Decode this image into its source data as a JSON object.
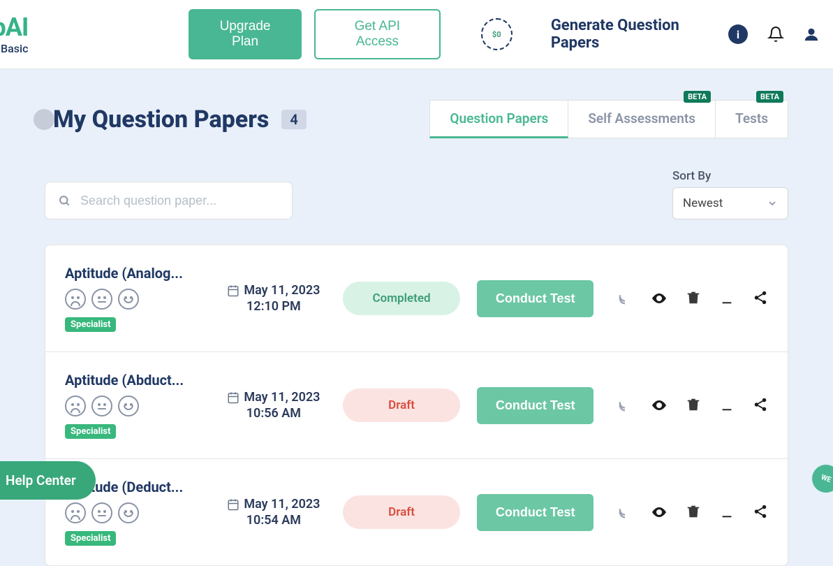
{
  "brand": {
    "main": "epAI",
    "sub": "Basic"
  },
  "header": {
    "upgrade_label": "Upgrade Plan",
    "api_label": "Get API Access",
    "credit": "$0",
    "generate_label": "Generate Question Papers"
  },
  "page": {
    "title": "My Question Papers",
    "count": "4"
  },
  "tabs": [
    {
      "label": "Question Papers",
      "active": true,
      "beta": false
    },
    {
      "label": "Self Assessments",
      "active": false,
      "beta": true
    },
    {
      "label": "Tests",
      "active": false,
      "beta": true
    }
  ],
  "search": {
    "placeholder": "Search question paper..."
  },
  "sort": {
    "label": "Sort By",
    "value": "Newest"
  },
  "status_labels": {
    "completed": "Completed",
    "draft": "Draft"
  },
  "conduct_label": "Conduct Test",
  "tag_label": "Specialist",
  "beta_label": "BETA",
  "papers": [
    {
      "title": "Aptitude (Analog...",
      "date": "May 11, 2023",
      "time": "12:10 PM",
      "status": "completed"
    },
    {
      "title": "Aptitude (Abduct...",
      "date": "May 11, 2023",
      "time": "10:56 AM",
      "status": "draft"
    },
    {
      "title": "Aptitude (Deduct...",
      "date": "May 11, 2023",
      "time": "10:54 AM",
      "status": "draft"
    }
  ],
  "help_center": "Help Center",
  "floating_text": "WE"
}
